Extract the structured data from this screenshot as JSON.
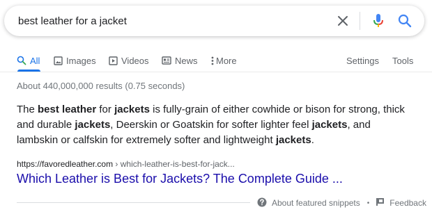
{
  "search": {
    "query": "best leather for a jacket"
  },
  "tabs": [
    {
      "label": "All",
      "icon": "search-icon",
      "active": true
    },
    {
      "label": "Images",
      "icon": "image-icon"
    },
    {
      "label": "Videos",
      "icon": "video-icon"
    },
    {
      "label": "News",
      "icon": "news-icon"
    },
    {
      "label": "More",
      "icon": "more-vert-icon"
    }
  ],
  "tools": {
    "settings_label": "Settings",
    "tools_label": "Tools"
  },
  "stats": "About 440,000,000 results (0.75 seconds)",
  "snippet": {
    "segments": [
      {
        "text": "The ",
        "bold": false
      },
      {
        "text": "best leather",
        "bold": true
      },
      {
        "text": " for ",
        "bold": false
      },
      {
        "text": "jackets",
        "bold": true
      },
      {
        "text": " is fully-grain of either cowhide or bison for strong, thick and durable ",
        "bold": false
      },
      {
        "text": "jackets",
        "bold": true
      },
      {
        "text": ", Deerskin or Goatskin for softer lighter feel ",
        "bold": false
      },
      {
        "text": "jackets",
        "bold": true
      },
      {
        "text": ", and lambskin or calfskin for extremely softer and lightweight ",
        "bold": false
      },
      {
        "text": "jackets",
        "bold": true
      },
      {
        "text": ".",
        "bold": false
      }
    ]
  },
  "result": {
    "cite_domain": "https://favoredleather.com",
    "cite_path": " › which-leather-is-best-for-jack...",
    "title": "Which Leather is Best for Jackets? The Complete Guide ..."
  },
  "footer": {
    "about_label": "About featured snippets",
    "separator": "•",
    "feedback_label": "Feedback"
  },
  "colors": {
    "accent": "#1a73e8",
    "link": "#1a0dab",
    "mic_blue": "#4285f4",
    "mic_red": "#ea4335",
    "mic_yellow": "#fbbc04",
    "mic_green": "#34a853"
  }
}
